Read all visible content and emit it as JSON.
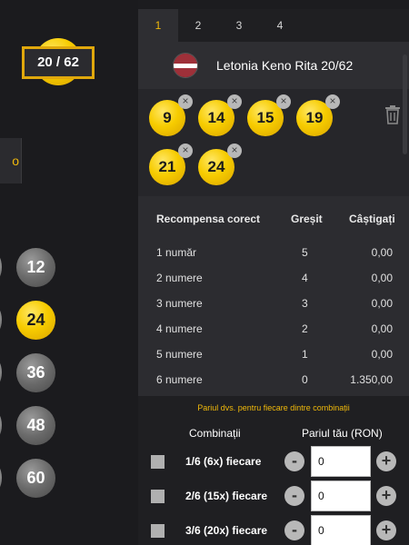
{
  "left": {
    "counter": "20 / 62",
    "side_button_label": "o",
    "balls": [
      "12",
      "24",
      "36",
      "48",
      "60"
    ]
  },
  "panel": {
    "tabs": [
      "1",
      "2",
      "3",
      "4"
    ],
    "active_tab": "1",
    "title": "Letonia Keno Rita 20/62",
    "flag": {
      "colors": [
        "#9e3039",
        "#ffffff",
        "#9e3039"
      ]
    },
    "picked": [
      "9",
      "14",
      "15",
      "19",
      "21",
      "24"
    ],
    "remove_symbol": "×"
  },
  "paytable": {
    "headers": {
      "correct": "Recompensa corect",
      "wrong": "Greșit",
      "win": "Câștigați"
    },
    "rows": [
      {
        "label": "1 număr",
        "wrong": "5",
        "win": "0,00"
      },
      {
        "label": "2 numere",
        "wrong": "4",
        "win": "0,00"
      },
      {
        "label": "3 numere",
        "wrong": "3",
        "win": "0,00"
      },
      {
        "label": "4 numere",
        "wrong": "2",
        "win": "0,00"
      },
      {
        "label": "5 numere",
        "wrong": "1",
        "win": "0,00"
      },
      {
        "label": "6 numere",
        "wrong": "0",
        "win": "1.350,00"
      }
    ]
  },
  "bets": {
    "note": "Pariul dvs. pentru fiecare dintre combinații",
    "col_combinations": "Combinații",
    "col_bet": "Pariul tău (RON)",
    "minus": "-",
    "plus": "+",
    "rows": [
      {
        "label": "1/6 (6x) fiecare",
        "value": "0"
      },
      {
        "label": "2/6 (15x) fiecare",
        "value": "0"
      },
      {
        "label": "3/6 (20x) fiecare",
        "value": "0"
      }
    ]
  },
  "colors": {
    "accent": "#f0b90b",
    "ball_yellow": "#f7cc00",
    "panel_bg": "#29292d"
  }
}
